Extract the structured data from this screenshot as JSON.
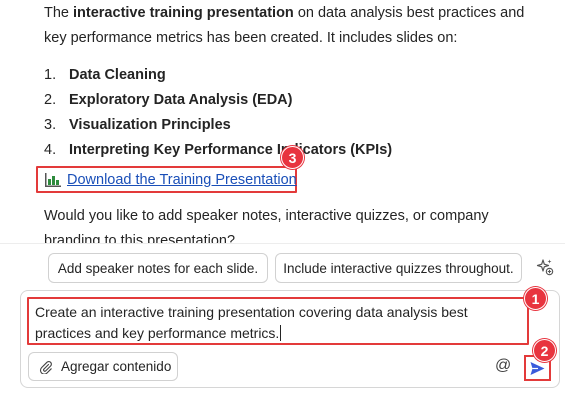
{
  "message": {
    "intro_pre": "The ",
    "intro_bold": "interactive training presentation",
    "intro_post": " on data analysis best practices and key performance metrics has been created. It includes slides on:",
    "slides": [
      {
        "num": "1.",
        "name": "Data Cleaning"
      },
      {
        "num": "2.",
        "name": "Exploratory Data Analysis (EDA)"
      },
      {
        "num": "3.",
        "name": "Visualization Principles"
      },
      {
        "num": "4.",
        "name": "Interpreting Key Performance Indicators (KPIs)"
      }
    ],
    "download_link": "Download the Training Presentation",
    "question": "Would you like to add speaker notes, interactive quizzes, or company branding to this presentation?"
  },
  "suggestions": [
    "Add speaker notes for each slide.",
    "Include interactive quizzes throughout."
  ],
  "composer": {
    "prompt_text": "Create an interactive training presentation covering data analysis best practices and key performance metrics.",
    "attach_label": "Agregar contenido",
    "mention_symbol": "@"
  },
  "annotations": {
    "badge_1": "1",
    "badge_2": "2",
    "badge_3": "3"
  },
  "icons": {
    "download": "bar-chart-icon",
    "attach": "paperclip-icon",
    "send": "send-icon",
    "suggest": "sparkle-icon",
    "mention": "mention-icon"
  },
  "colors": {
    "annotation": "#e33a3a",
    "link": "#1a4fb8",
    "send": "#3b5bdb"
  }
}
